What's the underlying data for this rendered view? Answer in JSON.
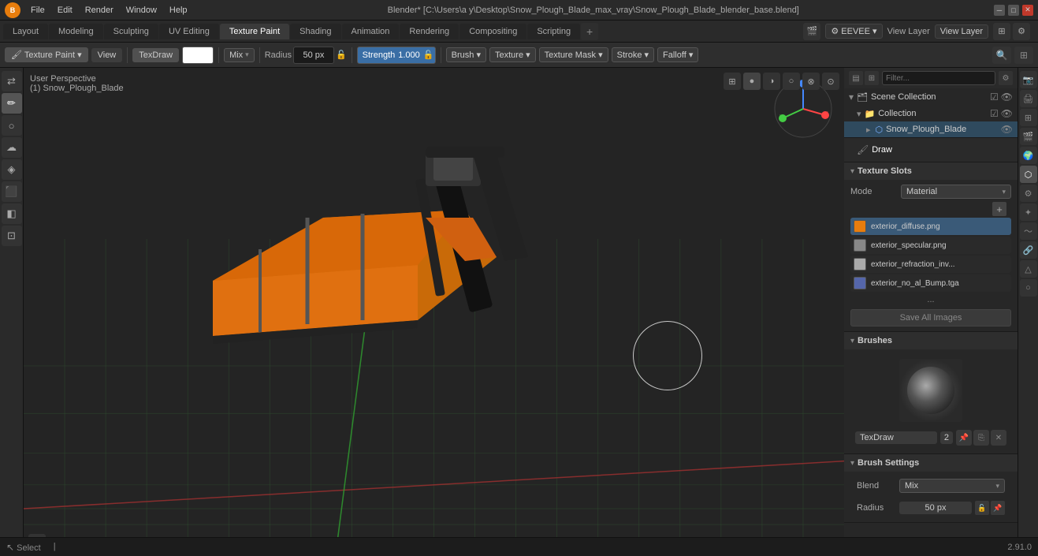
{
  "window": {
    "title": "Blender* [C:\\Users\\a y\\Desktop\\Snow_Plough_Blade_max_vray\\Snow_Plough_Blade_blender_base.blend]",
    "icon": "B"
  },
  "menus": [
    "File",
    "Edit",
    "Render",
    "Window",
    "Help"
  ],
  "tabs": [
    {
      "label": "Layout",
      "active": false
    },
    {
      "label": "Modeling",
      "active": false
    },
    {
      "label": "Sculpting",
      "active": false
    },
    {
      "label": "UV Editing",
      "active": false
    },
    {
      "label": "Texture Paint",
      "active": true
    },
    {
      "label": "Shading",
      "active": false
    },
    {
      "label": "Animation",
      "active": false
    },
    {
      "label": "Rendering",
      "active": false
    },
    {
      "label": "Compositing",
      "active": false
    },
    {
      "label": "Scripting",
      "active": false
    }
  ],
  "header": {
    "engine": "EEVEE",
    "view_layer_label": "View Layer",
    "view_layer_value": "View Layer"
  },
  "toolbar": {
    "mode_label": "Texture Paint",
    "view_label": "View",
    "brush_type": "TexDraw",
    "color_swatch": "white",
    "blend_label": "Mix",
    "radius_label": "Radius",
    "radius_value": "50 px",
    "strength_label": "Strength",
    "strength_value": "1.000",
    "brush_btn": "Brush ▾",
    "texture_btn": "Texture ▾",
    "texture_mask_btn": "Texture Mask ▾",
    "stroke_btn": "Stroke ▾",
    "falloff_btn": "Falloff ▾"
  },
  "viewport": {
    "info_line1": "User Perspective",
    "info_line2": "(1) Snow_Plough_Blade",
    "axis_labels": [
      "X",
      "Y",
      "Z"
    ]
  },
  "outliner": {
    "scene_collection": "Scene Collection",
    "collection": "Collection",
    "object": "Snow_Plough_Blade"
  },
  "properties": {
    "draw_label": "Draw",
    "texture_slots": {
      "title": "Texture Slots",
      "mode_label": "Mode",
      "mode_value": "Material",
      "items": [
        {
          "name": "exterior_diffuse.png",
          "color": "#e87d0d",
          "active": true
        },
        {
          "name": "exterior_specular.png",
          "color": "#888",
          "active": false
        },
        {
          "name": "exterior_refraction_inv...",
          "color": "#aaa",
          "active": false
        },
        {
          "name": "exterior_no_al_Bump.tga",
          "color": "#5566aa",
          "active": false
        }
      ],
      "more_label": "...",
      "save_all_label": "Save All Images"
    },
    "brushes": {
      "title": "Brushes",
      "brush_name": "TexDraw",
      "brush_num": "2"
    },
    "brush_settings": {
      "title": "Brush Settings",
      "blend_label": "Blend",
      "blend_value": "Mix",
      "radius_label": "Radius",
      "radius_value": "50 px"
    }
  },
  "statusbar": {
    "select_label": "Select",
    "version": "2.91.0",
    "cursor_label": ""
  }
}
